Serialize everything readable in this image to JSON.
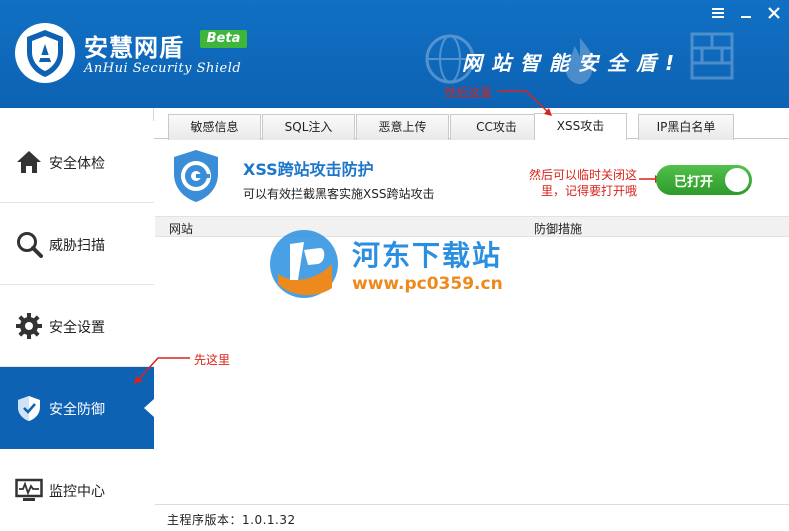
{
  "header": {
    "app_title": "安慧网盾",
    "beta_label": "Beta",
    "subtitle": "AnHui Security Shield",
    "slogan": "网站智能安全盾!",
    "menu_icon": "hamburger-icon",
    "close_icon": "close-icon"
  },
  "sidebar": {
    "items": [
      {
        "label": "安全体检",
        "icon": "home-icon"
      },
      {
        "label": "威胁扫描",
        "icon": "magnifier-icon"
      },
      {
        "label": "安全设置",
        "icon": "gear-icon"
      },
      {
        "label": "安全防御",
        "icon": "shield-icon",
        "active": true
      },
      {
        "label": "监控中心",
        "icon": "monitor-icon"
      }
    ]
  },
  "tabs": [
    {
      "label": "敏感信息"
    },
    {
      "label": "SQL注入"
    },
    {
      "label": "恶意上传"
    },
    {
      "label": "CC攻击"
    },
    {
      "label": "XSS攻击",
      "active": true
    },
    {
      "label": "IP黑白名单"
    }
  ],
  "protection": {
    "title": "XSS跨站攻击防护",
    "description": "可以有效拦截黑客实施XSS跨站攻击",
    "toggle_label": "已打开",
    "toggle_on": true
  },
  "table": {
    "columns": [
      "网站",
      "防御措施"
    ],
    "rows": []
  },
  "annotations": {
    "tab_note": "然后这里",
    "sidebar_note": "先这里",
    "toggle_note": "然后可以临时关闭这里，记得要打开哦"
  },
  "watermark": {
    "title": "河东下载站",
    "url": "www.pc0359.cn"
  },
  "footer": {
    "version_label": "主程序版本：1.0.1.32"
  },
  "colors": {
    "brand_blue": "#0d62b3",
    "accent_green": "#3db63b",
    "annotation_red": "#d9241c"
  }
}
